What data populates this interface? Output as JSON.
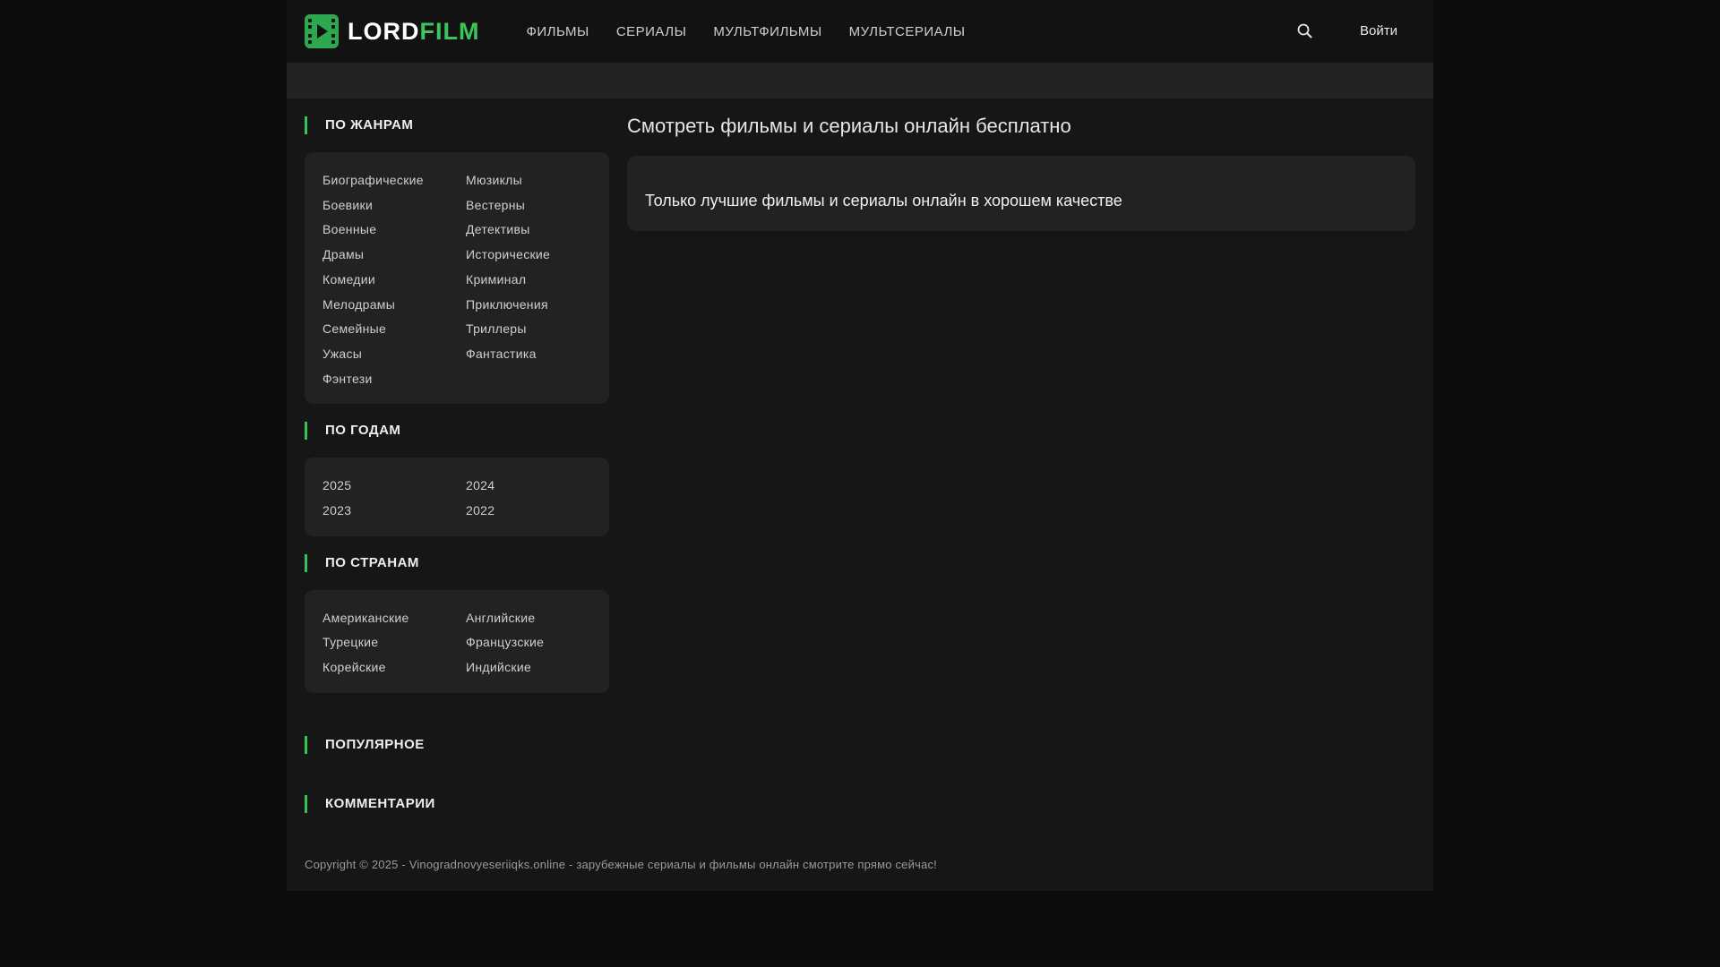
{
  "header": {
    "logo_part1": "LORD",
    "logo_part2": "FILM",
    "nav": [
      "ФИЛЬМЫ",
      "СЕРИАЛЫ",
      "МУЛЬТФИЛЬМЫ",
      "МУЛЬТСЕРИАЛЫ"
    ],
    "search_icon": "search-icon",
    "login": "Войти"
  },
  "sidebar": {
    "genres": {
      "title": "ПО ЖАНРАМ",
      "items": [
        "Биографические",
        "Мюзиклы",
        "Боевики",
        "Вестерны",
        "Военные",
        "Детективы",
        "Драмы",
        "Исторические",
        "Комедии",
        "Криминал",
        "Мелодрамы",
        "Приключения",
        "Семейные",
        "Триллеры",
        "Ужасы",
        "Фантастика",
        "Фэнтези"
      ]
    },
    "years": {
      "title": "ПО ГОДАМ",
      "items": [
        "2025",
        "2024",
        "2023",
        "2022"
      ]
    },
    "countries": {
      "title": "ПО СТРАНАМ",
      "items": [
        "Американские",
        "Английские",
        "Турецкие",
        "Французские",
        "Корейские",
        "Индийские"
      ]
    },
    "popular_title": "ПОПУЛЯРНОЕ",
    "comments_title": "КОММЕНТАРИИ"
  },
  "main": {
    "title": "Смотреть фильмы и сериалы онлайн бесплатно",
    "description": "Только лучшие фильмы и сериалы онлайн в хорошем качестве"
  },
  "footer": {
    "copyright": "Copyright © 2025 - Vinogradnovyeseriiqks.online - зарубежные сериалы и фильмы онлайн смотрите прямо сейчас!"
  },
  "colors": {
    "accent": "#33c457",
    "background": "#161616",
    "panel": "#222222"
  }
}
